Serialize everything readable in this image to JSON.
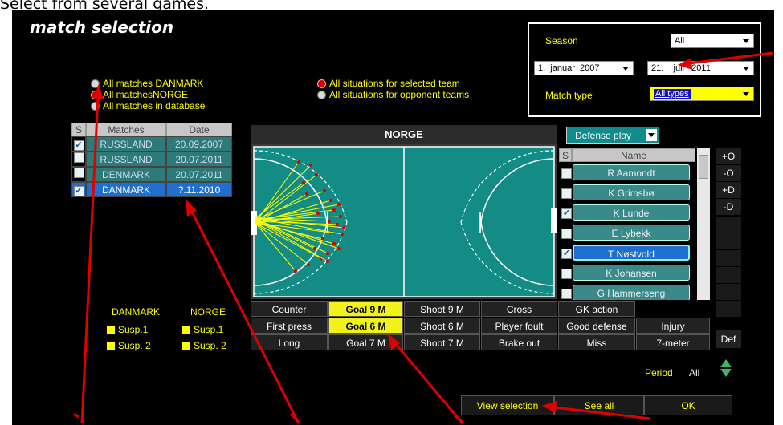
{
  "caption": "Select from several games.",
  "title": "match selection",
  "match_filter": [
    "All matches DANMARK",
    "All matchesNORGE",
    "All matches in database"
  ],
  "situation_filter": [
    "All situations for selected team",
    "All situations for opponent teams"
  ],
  "filter_panel": {
    "season_label": "Season",
    "season_value": "All",
    "from_day": "1.",
    "from_month": "januar",
    "from_year": "2007",
    "to_day": "21.",
    "to_month": "juli",
    "to_year": "2011",
    "match_type_label": "Match type",
    "match_type_value": "All types"
  },
  "matches_table": {
    "headers": [
      "S",
      "Matches",
      "Date"
    ],
    "rows": [
      {
        "checked": true,
        "team": "RUSSLAND",
        "date": "20.09.2007"
      },
      {
        "checked": false,
        "team": "RUSSLAND",
        "date": "20.07.2011"
      },
      {
        "checked": false,
        "team": "DENMARK",
        "date": "20.07.2011"
      },
      {
        "checked": true,
        "team": "DANMARK",
        "date": "?.11.2010",
        "selected": true
      }
    ]
  },
  "field_title": "NORGE",
  "play_mode": "Defense play",
  "player_list": {
    "headers": [
      "S",
      "Name"
    ],
    "players": [
      {
        "name": "R Aamondt",
        "checked": false
      },
      {
        "name": "K Grimsbø",
        "checked": false
      },
      {
        "name": "K Lunde",
        "checked": true
      },
      {
        "name": "E Lybekk",
        "checked": false
      },
      {
        "name": "T Nøstvold",
        "checked": true,
        "selected": true
      },
      {
        "name": "K Johansen",
        "checked": false
      },
      {
        "name": "G Hammerseng",
        "checked": false
      }
    ]
  },
  "side_buttons": [
    "+O",
    "-O",
    "+D",
    "-D"
  ],
  "def_button": "Def",
  "team_legend": {
    "team1": "DANMARK",
    "team2": "NORGE",
    "susp1": "Susp.1",
    "susp2": "Susp. 2"
  },
  "situation_buttons": [
    [
      "Counter",
      "Goal 9 M",
      "Shoot 9 M",
      "Cross",
      "GK action"
    ],
    [
      "First press",
      "Goal 6 M",
      "Shoot 6 M",
      "Player foult",
      "Good defense",
      "Injury"
    ],
    [
      "Long",
      "Goal 7 M",
      "Shoot 7 M",
      "Brake out",
      "Miss",
      "7-meter"
    ]
  ],
  "period_label": "Period",
  "period_value": "All",
  "bottom_buttons": [
    "View selection",
    "See all",
    "OK"
  ],
  "colors": {
    "accent": "#ffff00",
    "field": "#148c86",
    "arrow": "#e00000",
    "selected": "#1e6fd0"
  }
}
